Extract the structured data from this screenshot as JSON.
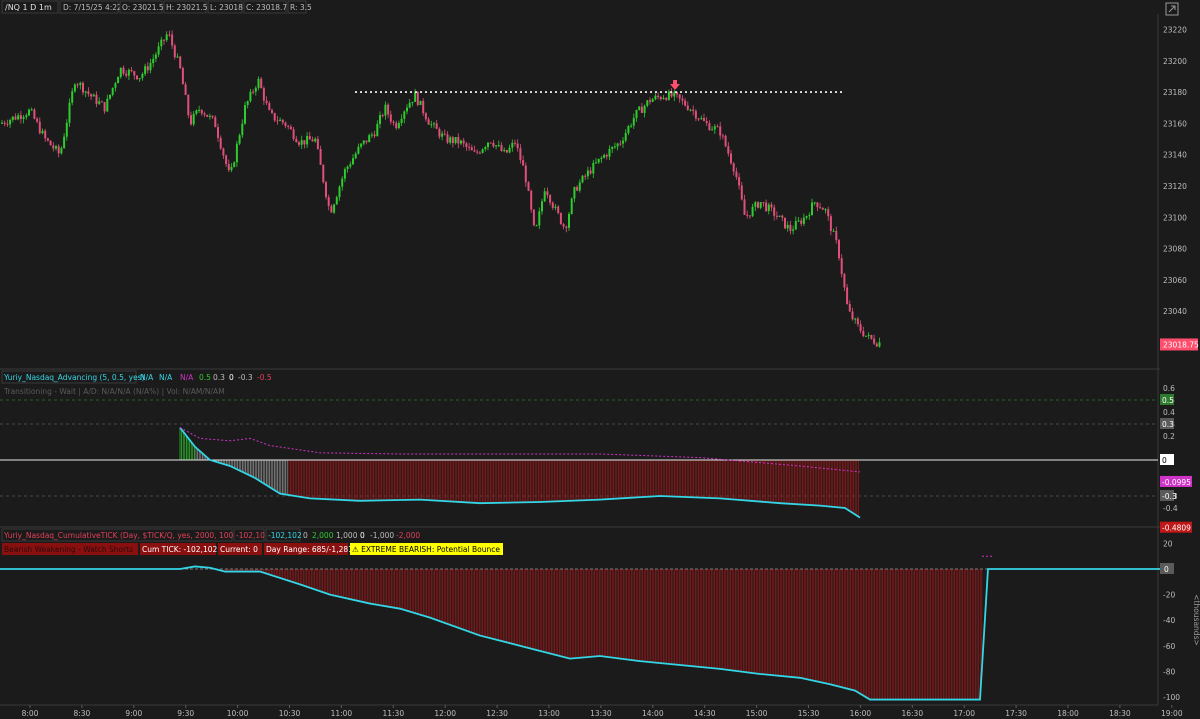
{
  "colors": {
    "background": "#1b1b1b",
    "up": "#2ecc2e",
    "down": "#e0507a",
    "tick_line": "#33d6e6",
    "zero_line": "#e8e8e8",
    "bar_red": "#a01818",
    "bar_gray": "#9a9a9a",
    "mag_dash": "#d033c8",
    "price_tag": "#ff4d6d",
    "yellow_badge": "#ffff00",
    "grid_dash": "#5a5a5a"
  },
  "header": {
    "symbol": "/NQ 1 D 1m",
    "date": "D: 7/15/25 4:22 PM",
    "open": "O: 23021.5",
    "high": "H: 23021.5",
    "low": "L: 23018",
    "close": "C: 23018.75",
    "range": "R: 3.5"
  },
  "chart_data": [
    {
      "type": "candlestick",
      "name": "/NQ 1 D 1m",
      "y_ticks": [
        23040,
        23060,
        23080,
        23100,
        23120,
        23140,
        23160,
        23180,
        23200,
        23220
      ],
      "last_price_label": "23018.75",
      "close_path": [
        [
          0,
          23160
        ],
        [
          30,
          23168
        ],
        [
          45,
          23150
        ],
        [
          60,
          23140
        ],
        [
          75,
          23188
        ],
        [
          90,
          23178
        ],
        [
          105,
          23170
        ],
        [
          120,
          23195
        ],
        [
          140,
          23190
        ],
        [
          150,
          23198
        ],
        [
          168,
          23218
        ],
        [
          180,
          23195
        ],
        [
          190,
          23160
        ],
        [
          200,
          23170
        ],
        [
          215,
          23160
        ],
        [
          230,
          23125
        ],
        [
          245,
          23170
        ],
        [
          258,
          23188
        ],
        [
          270,
          23165
        ],
        [
          285,
          23160
        ],
        [
          300,
          23148
        ],
        [
          315,
          23150
        ],
        [
          330,
          23103
        ],
        [
          345,
          23130
        ],
        [
          360,
          23145
        ],
        [
          375,
          23155
        ],
        [
          385,
          23170
        ],
        [
          395,
          23158
        ],
        [
          405,
          23170
        ],
        [
          415,
          23178
        ],
        [
          430,
          23160
        ],
        [
          445,
          23150
        ],
        [
          460,
          23148
        ],
        [
          475,
          23140
        ],
        [
          490,
          23150
        ],
        [
          505,
          23140
        ],
        [
          515,
          23148
        ],
        [
          525,
          23128
        ],
        [
          535,
          23088
        ],
        [
          545,
          23120
        ],
        [
          555,
          23105
        ],
        [
          565,
          23093
        ],
        [
          575,
          23118
        ],
        [
          590,
          23130
        ],
        [
          605,
          23140
        ],
        [
          620,
          23148
        ],
        [
          635,
          23165
        ],
        [
          650,
          23175
        ],
        [
          665,
          23178
        ],
        [
          675,
          23177
        ],
        [
          690,
          23170
        ],
        [
          705,
          23160
        ],
        [
          720,
          23155
        ],
        [
          735,
          23130
        ],
        [
          745,
          23100
        ],
        [
          760,
          23110
        ],
        [
          775,
          23102
        ],
        [
          790,
          23092
        ],
        [
          805,
          23100
        ],
        [
          815,
          23110
        ],
        [
          825,
          23105
        ],
        [
          838,
          23080
        ],
        [
          848,
          23040
        ],
        [
          858,
          23030
        ],
        [
          868,
          23023
        ],
        [
          878,
          23020
        ]
      ],
      "resistance_level": 23180,
      "annotations": [
        "sell-arrow"
      ]
    },
    {
      "type": "line",
      "name": "Yuriy_Nasdaq_Advancing",
      "y_ticks": [
        -0.4,
        -0.3,
        -0.2,
        0,
        0.2,
        0.3,
        0.4,
        0.5,
        0.6
      ],
      "tick_labels": [
        "-0.4",
        "-0.3",
        "-0.2",
        "0",
        "0.2",
        "0.3",
        "0.4",
        "0.5",
        "0.6"
      ],
      "levels": [
        0.5,
        0.3,
        -0.3
      ],
      "series": [
        {
          "values": [
            [
              180,
              0.27
            ],
            [
              195,
              0.11
            ],
            [
              210,
              0.0
            ],
            [
              230,
              -0.05
            ],
            [
              255,
              -0.15
            ],
            [
              280,
              -0.28
            ],
            [
              310,
              -0.32
            ],
            [
              360,
              -0.34
            ],
            [
              420,
              -0.33
            ],
            [
              480,
              -0.36
            ],
            [
              540,
              -0.35
            ],
            [
              600,
              -0.33
            ],
            [
              660,
              -0.3
            ],
            [
              720,
              -0.32
            ],
            [
              780,
              -0.36
            ],
            [
              820,
              -0.38
            ],
            [
              845,
              -0.4
            ],
            [
              860,
              -0.48
            ]
          ]
        },
        {
          "values": [
            [
              180,
              0.27
            ],
            [
              200,
              0.18
            ],
            [
              230,
              0.16
            ],
            [
              250,
              0.18
            ],
            [
              270,
              0.12
            ],
            [
              320,
              0.06
            ],
            [
              400,
              0.05
            ],
            [
              500,
              0.05
            ],
            [
              600,
              0.05
            ],
            [
              700,
              0.02
            ],
            [
              800,
              -0.05
            ],
            [
              860,
              -0.0995
            ]
          ]
        }
      ],
      "value_labels": [
        "0.5",
        "0.3",
        "0",
        "-0.0995",
        "-0.3",
        "-0.4809"
      ]
    },
    {
      "type": "area",
      "name": "Yuriy_Nasdaq_CumulativeTICK",
      "unit_label": "<thousands>",
      "y_ticks": [
        -100,
        -80,
        -60,
        -40,
        -20,
        0,
        20
      ],
      "tick_labels": [
        "-100",
        "-80",
        "-60",
        "-40",
        "-20",
        "0",
        "20"
      ],
      "series": [
        {
          "values": [
            [
              0,
              0
            ],
            [
              180,
              0
            ],
            [
              195,
              2
            ],
            [
              210,
              1
            ],
            [
              225,
              -2
            ],
            [
              260,
              -2
            ],
            [
              300,
              -12
            ],
            [
              330,
              -20
            ],
            [
              370,
              -27
            ],
            [
              400,
              -31
            ],
            [
              430,
              -38
            ],
            [
              480,
              -52
            ],
            [
              530,
              -62
            ],
            [
              570,
              -70
            ],
            [
              600,
              -68
            ],
            [
              640,
              -72
            ],
            [
              680,
              -75
            ],
            [
              720,
              -78
            ],
            [
              760,
              -82
            ],
            [
              800,
              -85
            ],
            [
              830,
              -90
            ],
            [
              855,
              -95
            ],
            [
              870,
              -102
            ],
            [
              980,
              -102
            ],
            [
              988,
              0
            ],
            [
              1160,
              0
            ]
          ]
        }
      ],
      "value_labels": [
        "0"
      ]
    }
  ],
  "x_axis": {
    "ticks": [
      "8:00",
      "8:30",
      "9:00",
      "9:30",
      "10:00",
      "10:30",
      "11:00",
      "11:30",
      "12:00",
      "12:30",
      "13:00",
      "13:30",
      "14:00",
      "14:30",
      "15:00",
      "15:30",
      "16:00",
      "16:30",
      "17:00",
      "17:30",
      "18:00",
      "18:30",
      "19:00"
    ]
  },
  "indicators": {
    "advancing": {
      "title": "Yuriy_Nasdaq_Advancing (5, 0.5, yes)",
      "values": [
        "N/A",
        "N/A",
        "N/A",
        "0.5",
        "0.3",
        "0",
        "-0.3",
        "-0.5"
      ],
      "subtitle": "Transitioning - Wait | A/D: N/A/N/A (N/A%) | Vol: N/AM/N/AM"
    },
    "cumtick": {
      "title": "Yuriy_Nasdaq_CumulativeTICK (Day, $TICK/Q, yes, 2000, 1000, 5)",
      "values": [
        "-102,102",
        "-102,102",
        "0",
        "2,000",
        "1,000",
        "0",
        "-1,000",
        "-2,000"
      ],
      "status": [
        "Bearish Weakening - Watch Shorts",
        "Cum TICK: -102,102",
        "Current: 0",
        "Day Range: 685/-1,281"
      ],
      "alert": "⚠ EXTREME BEARISH: Potential Bounce"
    }
  }
}
